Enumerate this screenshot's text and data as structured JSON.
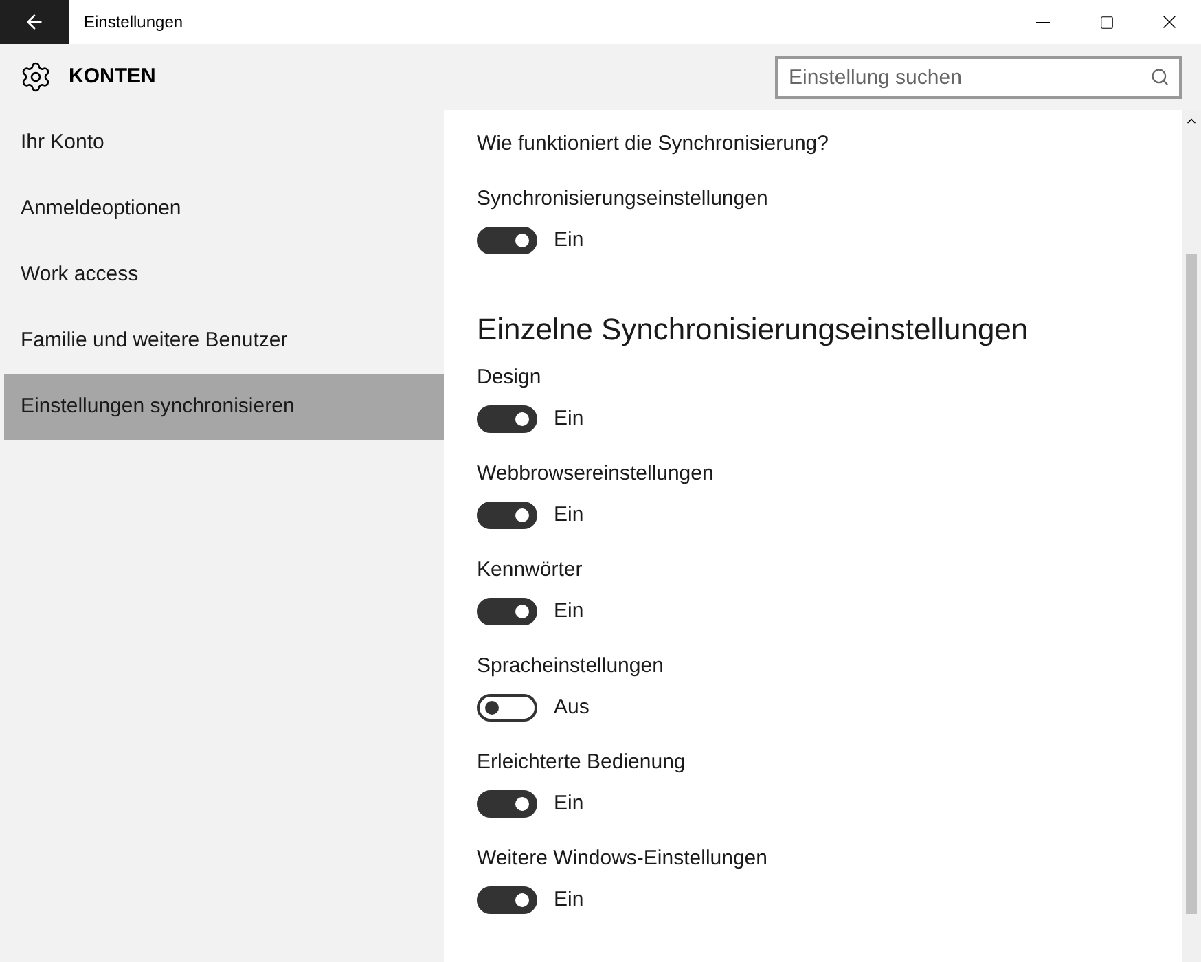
{
  "window": {
    "title": "Einstellungen"
  },
  "header": {
    "title": "KONTEN",
    "search": {
      "placeholder": "Einstellung suchen"
    }
  },
  "sidebar": {
    "items": [
      {
        "label": "Ihr Konto",
        "selected": false
      },
      {
        "label": "Anmeldeoptionen",
        "selected": false
      },
      {
        "label": "Work access",
        "selected": false
      },
      {
        "label": "Familie und weitere Benutzer",
        "selected": false
      },
      {
        "label": "Einstellungen synchronisieren",
        "selected": true
      }
    ]
  },
  "content": {
    "link": "Wie funktioniert die Synchronisierung?",
    "main_setting": {
      "label": "Synchronisierungseinstellungen",
      "on": true,
      "state": "Ein"
    },
    "heading": "Einzelne Synchronisierungseinstellungen",
    "settings": [
      {
        "label": "Design",
        "on": true,
        "state": "Ein"
      },
      {
        "label": "Webbrowsereinstellungen",
        "on": true,
        "state": "Ein"
      },
      {
        "label": "Kennwörter",
        "on": true,
        "state": "Ein"
      },
      {
        "label": "Spracheinstellungen",
        "on": false,
        "state": "Aus"
      },
      {
        "label": "Erleichterte Bedienung",
        "on": true,
        "state": "Ein"
      },
      {
        "label": "Weitere Windows-Einstellungen",
        "on": true,
        "state": "Ein"
      }
    ]
  }
}
